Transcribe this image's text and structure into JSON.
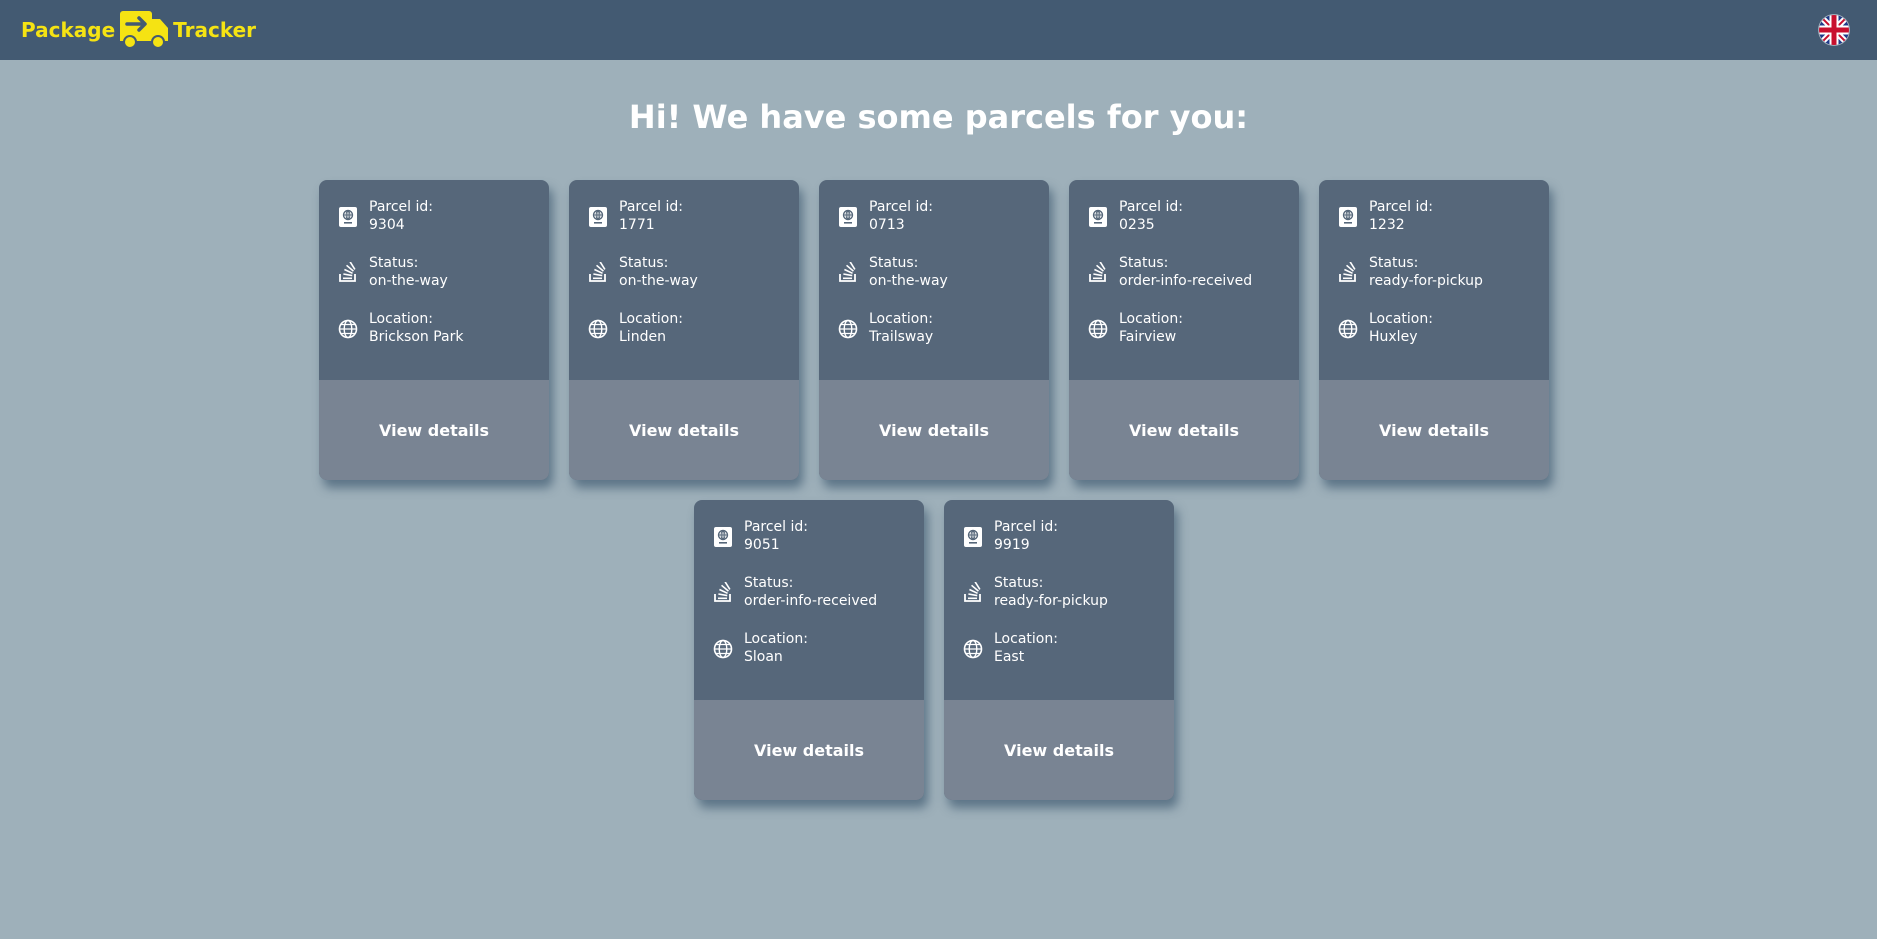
{
  "header": {
    "brand_left": "Package",
    "brand_right": "Tracker",
    "language_icon": "uk-flag-icon"
  },
  "main": {
    "heading": "Hi! We have some parcels for you:"
  },
  "labels": {
    "parcel_id": "Parcel id:",
    "status": "Status:",
    "location": "Location:",
    "view_details": "View details"
  },
  "parcels": [
    {
      "id": "9304",
      "status": "on-the-way",
      "location": "Brickson Park"
    },
    {
      "id": "1771",
      "status": "on-the-way",
      "location": "Linden"
    },
    {
      "id": "0713",
      "status": "on-the-way",
      "location": "Trailsway"
    },
    {
      "id": "0235",
      "status": "order-info-received",
      "location": "Fairview"
    },
    {
      "id": "1232",
      "status": "ready-for-pickup",
      "location": "Huxley"
    },
    {
      "id": "9051",
      "status": "order-info-received",
      "location": "Sloan"
    },
    {
      "id": "9919",
      "status": "ready-for-pickup",
      "location": "East"
    }
  ],
  "colors": {
    "background": "#9eb0ba",
    "header": "#435a72",
    "brand": "#f5e313",
    "card_body": "#56677a",
    "card_footer": "#798493"
  }
}
